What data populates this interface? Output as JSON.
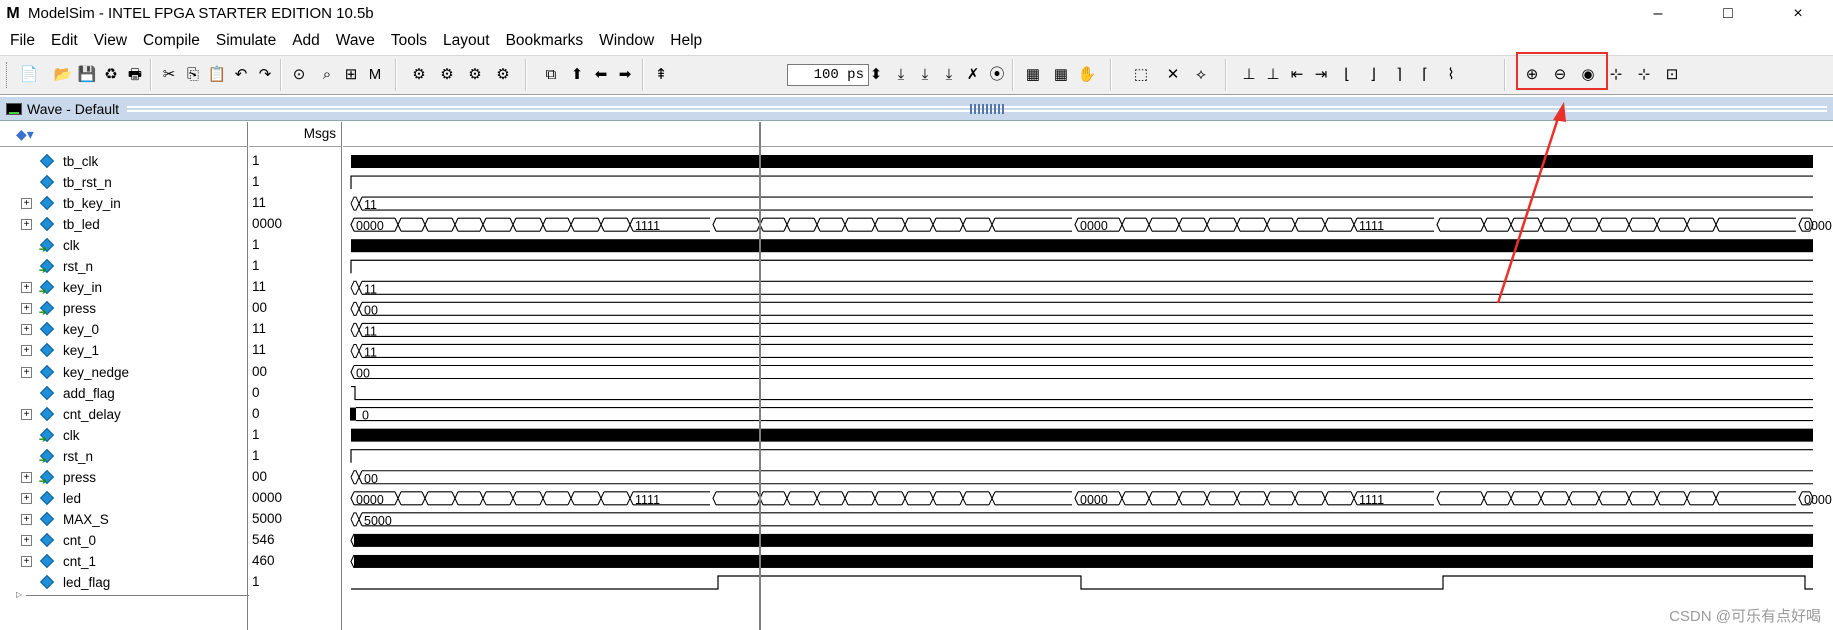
{
  "window": {
    "title": "ModelSim - INTEL FPGA STARTER EDITION 10.5b",
    "app_icon": "M",
    "controls": [
      "–",
      "□",
      "×"
    ]
  },
  "menu": [
    "File",
    "Edit",
    "View",
    "Compile",
    "Simulate",
    "Add",
    "Wave",
    "Tools",
    "Layout",
    "Bookmarks",
    "Window",
    "Help"
  ],
  "toolbar": {
    "run_length": "100 ps"
  },
  "wave_window": {
    "title": "Wave - Default",
    "msgs_header": "Msgs"
  },
  "signals": [
    {
      "name": "tb_clk",
      "value": "1",
      "expandable": false,
      "kind": "clock"
    },
    {
      "name": "tb_rst_n",
      "value": "1",
      "expandable": false,
      "kind": "rise_early"
    },
    {
      "name": "tb_key_in",
      "value": "11",
      "expandable": true,
      "kind": "bus_short",
      "label": "11"
    },
    {
      "name": "tb_led",
      "value": "0000",
      "expandable": true,
      "kind": "bus_led"
    },
    {
      "name": "clk",
      "value": "1",
      "expandable": false,
      "kind": "clock"
    },
    {
      "name": "rst_n",
      "value": "1",
      "expandable": false,
      "kind": "rise_early"
    },
    {
      "name": "key_in",
      "value": "11",
      "expandable": true,
      "kind": "bus_short",
      "label": "11"
    },
    {
      "name": "press",
      "value": "00",
      "expandable": true,
      "kind": "bus_short",
      "label": "00"
    },
    {
      "name": "key_0",
      "value": "11",
      "expandable": true,
      "kind": "bus_short",
      "label": "11"
    },
    {
      "name": "key_1",
      "value": "11",
      "expandable": true,
      "kind": "bus_short",
      "label": "11"
    },
    {
      "name": "key_nedge",
      "value": "00",
      "expandable": true,
      "kind": "bus_const",
      "label": "00"
    },
    {
      "name": "add_flag",
      "value": "0",
      "expandable": false,
      "kind": "low_pulse"
    },
    {
      "name": "cnt_delay",
      "value": "0",
      "expandable": true,
      "kind": "bus_dense_start",
      "label": "0"
    },
    {
      "name": "clk",
      "value": "1",
      "expandable": false,
      "kind": "clock"
    },
    {
      "name": "rst_n",
      "value": "1",
      "expandable": false,
      "kind": "rise_early"
    },
    {
      "name": "press",
      "value": "00",
      "expandable": true,
      "kind": "bus_short",
      "label": "00"
    },
    {
      "name": "led",
      "value": "0000",
      "expandable": true,
      "kind": "bus_led"
    },
    {
      "name": "MAX_S",
      "value": "5000",
      "expandable": true,
      "kind": "bus_short",
      "label": "5000"
    },
    {
      "name": "cnt_0",
      "value": "546",
      "expandable": true,
      "kind": "bus_dense"
    },
    {
      "name": "cnt_1",
      "value": "460",
      "expandable": true,
      "kind": "bus_dense"
    },
    {
      "name": "led_flag",
      "value": "1",
      "expandable": false,
      "kind": "toggle"
    }
  ],
  "led_bus_labels": [
    "0000",
    "1111",
    "0000",
    "1111",
    "0000"
  ],
  "watermark": "CSDN @可乐有点好喝",
  "colors": {
    "annotation": "#e8312a",
    "wave": "#000000",
    "highlight_box": "#e8312a"
  }
}
